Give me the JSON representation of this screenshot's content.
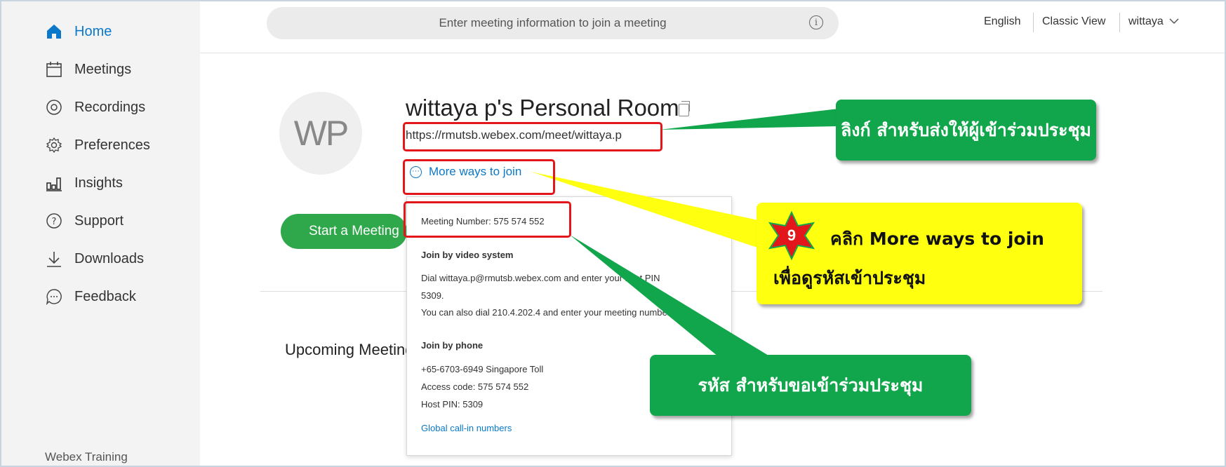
{
  "sidebar": {
    "items": [
      {
        "label": "Home",
        "icon": "home-icon"
      },
      {
        "label": "Meetings",
        "icon": "calendar-icon"
      },
      {
        "label": "Recordings",
        "icon": "record-icon"
      },
      {
        "label": "Preferences",
        "icon": "gear-icon"
      },
      {
        "label": "Insights",
        "icon": "bar-chart-icon"
      },
      {
        "label": "Support",
        "icon": "help-icon"
      },
      {
        "label": "Downloads",
        "icon": "download-icon"
      },
      {
        "label": "Feedback",
        "icon": "feedback-icon"
      }
    ],
    "footer": "Webex Training",
    "active_color": "#0b78c9"
  },
  "header": {
    "search_placeholder": "Enter meeting information to join a meeting",
    "language": "English",
    "classic_view": "Classic View",
    "user": "wittaya",
    "info_icon": "info-icon"
  },
  "room": {
    "avatar_initials": "WP",
    "title": "wittaya p's Personal Room",
    "link": "https://rmutsb.webex.com/meet/wittaya.p",
    "more_ways": "More ways to join",
    "start_button": "Start a Meeting",
    "upcoming": "Upcoming Meetings"
  },
  "popup": {
    "meeting_number": "Meeting Number: 575 574 552",
    "video_heading": "Join by video system",
    "video_line1": "Dial wittaya.p@rmutsb.webex.com and enter your host PIN",
    "video_line2": "5309.",
    "video_line3": "You can also dial 210.4.202.4 and enter your meeting number.",
    "phone_heading": "Join by phone",
    "phone_number": "+65-6703-6949 Singapore Toll",
    "access_code": "Access code: 575 574 552",
    "host_pin": "Host PIN: 5309",
    "global_link": "Global call-in numbers"
  },
  "annotations": {
    "link_callout": "ลิงก์ สำหรับส่งให้ผู้เข้าร่วมประชุม",
    "step_number": "9",
    "step_line1": "คลิก More ways to join",
    "step_line2": "เพื่อดูรหัสเข้าประชุม",
    "code_callout": "รหัส สำหรับขอเข้าร่วมประชุม",
    "green_color": "#11a64b",
    "yellow_color": "#ffff10",
    "red_color": "#e3161b"
  }
}
